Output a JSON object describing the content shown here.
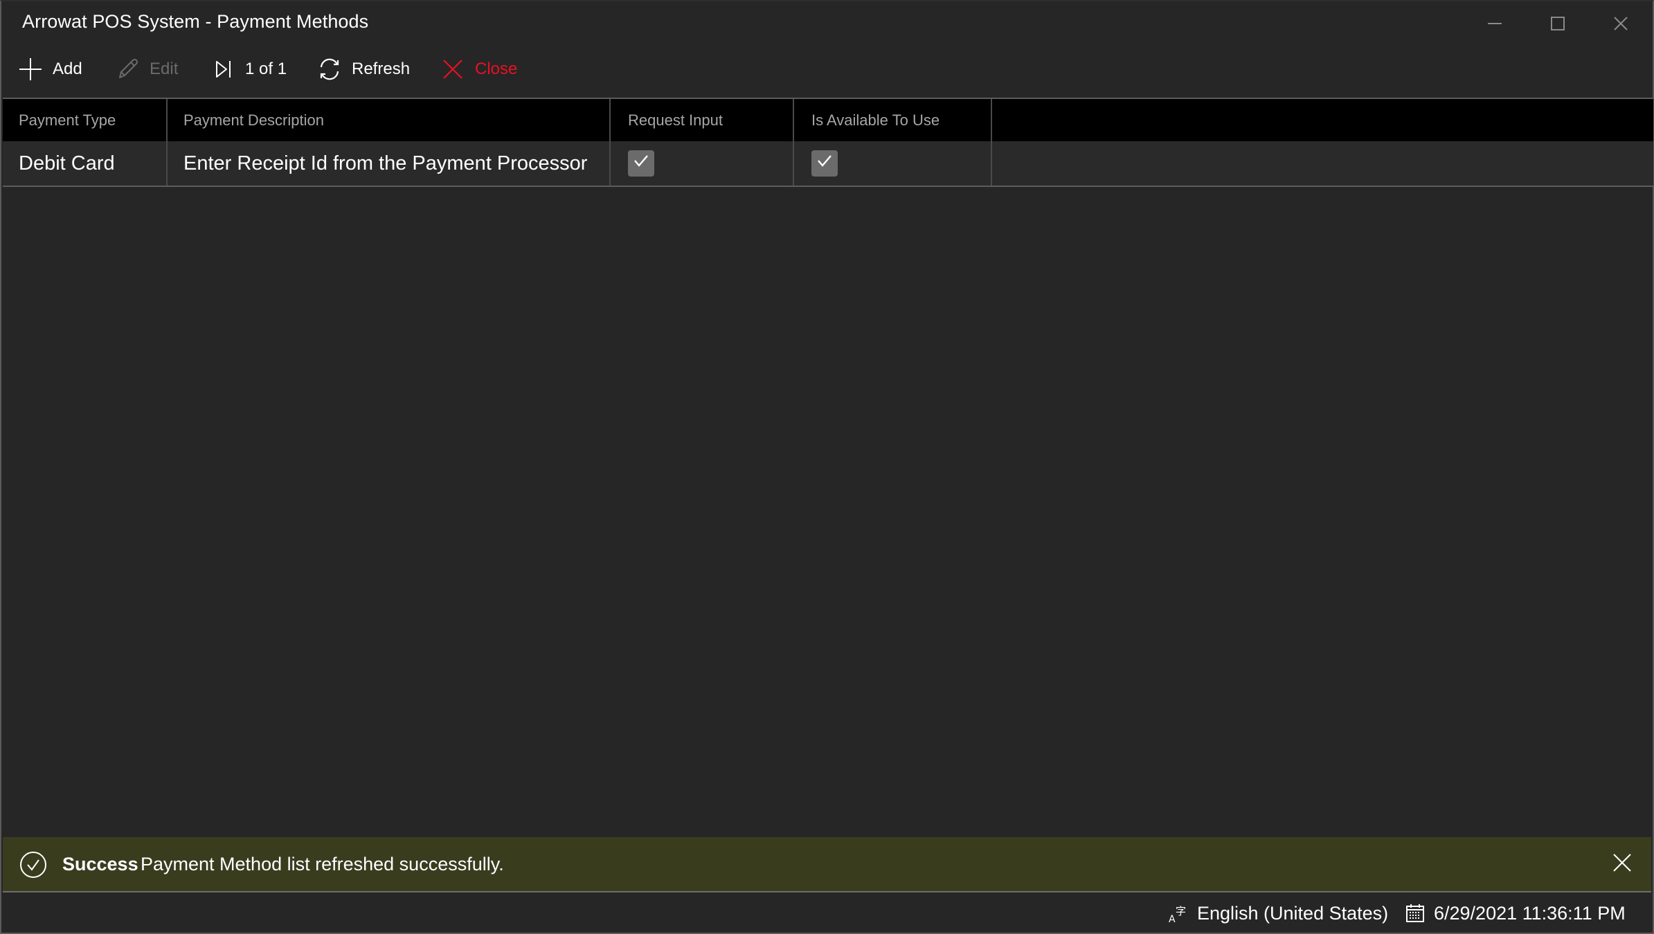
{
  "window": {
    "title": "Arrowat POS System - Payment Methods",
    "controls": {
      "minimize": "minimize-icon",
      "maximize": "maximize-icon",
      "close": "close-icon"
    }
  },
  "toolbar": {
    "add_label": "Add",
    "edit_label": "Edit",
    "edit_enabled": false,
    "pager_label": "1 of 1",
    "refresh_label": "Refresh",
    "close_label": "Close",
    "close_color": "#e81123"
  },
  "grid": {
    "columns": [
      {
        "header": "Payment Type"
      },
      {
        "header": "Payment Description"
      },
      {
        "header": "Request Input"
      },
      {
        "header": "Is Available To Use"
      }
    ],
    "rows": [
      {
        "payment_type": "Debit Card",
        "payment_description": "Enter Receipt Id from the Payment Processor",
        "request_input": true,
        "is_available_to_use": true
      }
    ]
  },
  "notification": {
    "severity": "Success",
    "title": "Success",
    "message": "Payment Method list refreshed successfully.",
    "background_color": "#393d1e"
  },
  "statusbar": {
    "language": "English (United States)",
    "datetime": "6/29/2021 11:36:11 PM"
  }
}
